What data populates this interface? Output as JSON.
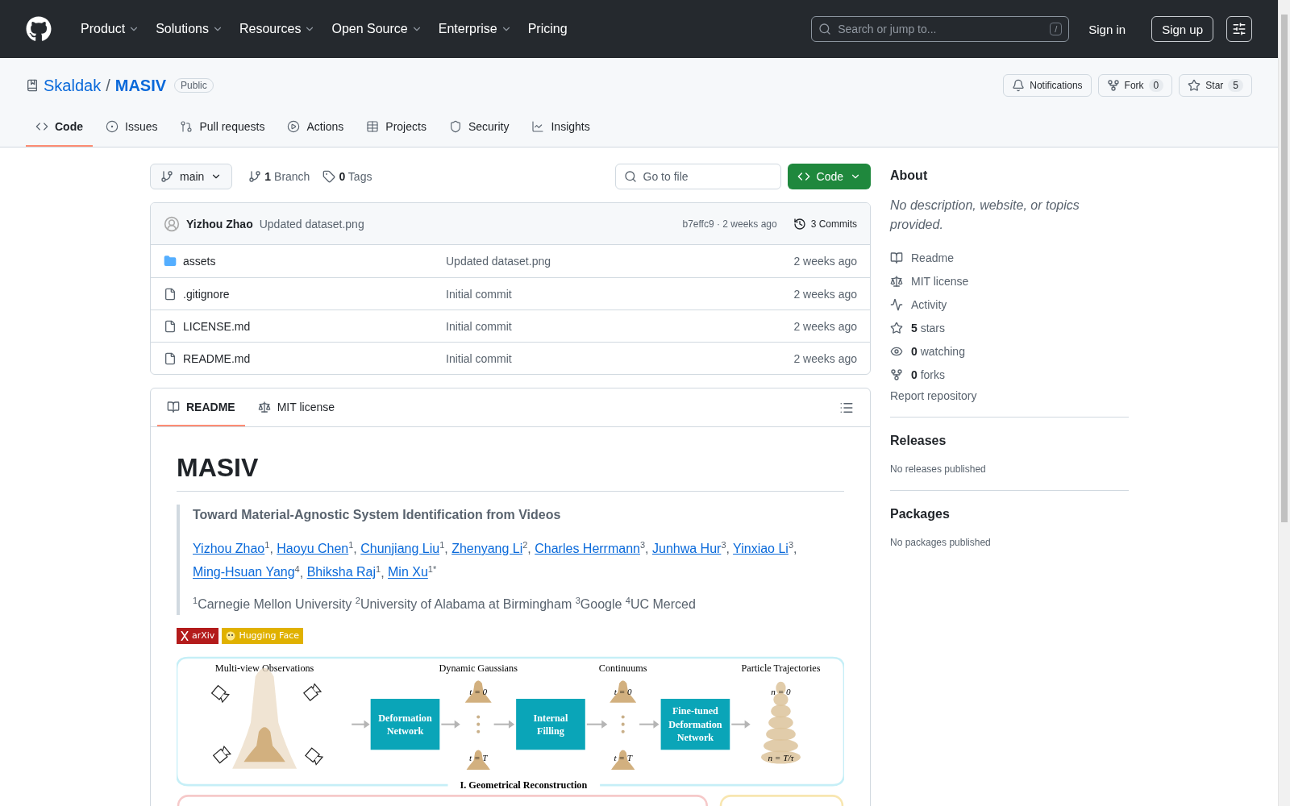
{
  "header": {
    "nav": [
      {
        "label": "Product",
        "dropdown": true
      },
      {
        "label": "Solutions",
        "dropdown": true
      },
      {
        "label": "Resources",
        "dropdown": true
      },
      {
        "label": "Open Source",
        "dropdown": true
      },
      {
        "label": "Enterprise",
        "dropdown": true
      },
      {
        "label": "Pricing",
        "dropdown": false
      }
    ],
    "search": {
      "placeholder": "Search or jump to...",
      "shortcut": "/"
    },
    "sign_in": "Sign in",
    "sign_up": "Sign up"
  },
  "repo": {
    "owner": "Skaldak",
    "separator": "/",
    "name": "MASIV",
    "visibility": "Public",
    "actions": [
      {
        "kind": "notifications",
        "label": "Notifications"
      },
      {
        "kind": "fork",
        "label": "Fork",
        "count": "0"
      },
      {
        "kind": "star",
        "label": "Star",
        "count": "5"
      }
    ],
    "tabs": [
      {
        "kind": "code",
        "label": "Code",
        "selected": true
      },
      {
        "kind": "issues",
        "label": "Issues",
        "selected": false
      },
      {
        "kind": "pulls",
        "label": "Pull requests",
        "selected": false
      },
      {
        "kind": "actions",
        "label": "Actions",
        "selected": false
      },
      {
        "kind": "projects",
        "label": "Projects",
        "selected": false
      },
      {
        "kind": "security",
        "label": "Security",
        "selected": false
      },
      {
        "kind": "insights",
        "label": "Insights",
        "selected": false
      }
    ]
  },
  "toolbar": {
    "branch": "main",
    "branches": "**1** Branch",
    "tags": "**0** Tags",
    "file_search": {
      "placeholder": "Go to file"
    },
    "code_button": "Code"
  },
  "latest_commit": {
    "author": "Yizhou Zhao",
    "message": "Updated dataset.png",
    "hash_age": "b7effc9 · 2 weeks ago",
    "commits": "3 Commits"
  },
  "files": [
    {
      "kind": "folder",
      "name": "assets",
      "message": "Updated dataset.png",
      "age": "2 weeks ago"
    },
    {
      "kind": "file",
      "name": ".gitignore",
      "message": "Initial commit",
      "age": "2 weeks ago"
    },
    {
      "kind": "file",
      "name": "LICENSE.md",
      "message": "Initial commit",
      "age": "2 weeks ago"
    },
    {
      "kind": "file",
      "name": "README.md",
      "message": "Initial commit",
      "age": "2 weeks ago"
    }
  ],
  "readme": {
    "tabs": [
      {
        "kind": "readme",
        "label": "README",
        "selected": true
      },
      {
        "kind": "license",
        "label": "MIT license",
        "selected": false
      }
    ],
    "title": "MASIV",
    "subtitle": "Toward Material-Agnostic System Identification from Videos",
    "authors": [
      {
        "name": "Yizhou Zhao",
        "note": "$^{1}$,"
      },
      {
        "name": "Haoyu Chen",
        "note": "$^{1}$,"
      },
      {
        "name": "Chunjiang Liu",
        "note": "$^{1}$,"
      },
      {
        "name": "Zhenyang Li",
        "note": "$^{2}$,"
      },
      {
        "name": "Charles Herrmann",
        "note": "$^{3}$,"
      },
      {
        "name": "Junhwa Hur",
        "note": "$^{3}$,"
      },
      {
        "name": "Yinxiao Li",
        "note": "$^{3}$,"
      },
      {
        "name": "Ming-Hsuan Yang",
        "note": "$^{4}$,"
      },
      {
        "name": "Bhiksha Raj",
        "note": "$^{1}$,"
      },
      {
        "name": "Min Xu",
        "note": "$^{1*}$"
      }
    ],
    "affiliations": "$^{1}$Carnegie Mellon University $^{2}$University of Alabama at Birmingham $^{3}$Google $^{4}$UC Merced",
    "badges": [
      {
        "kind": "arxiv",
        "label": "arXiv",
        "color": "#b31b1b"
      },
      {
        "kind": "huggingface",
        "label": "Hugging Face",
        "color": "#e0b100"
      }
    ],
    "figure": {
      "stages": [
        "Multi-view Observations",
        "Dynamic Gaussians",
        "Continuums",
        "Particle Trajectories"
      ],
      "blocks": [
        {
          "lines": [
            "Deformation",
            "Network"
          ]
        },
        {
          "lines": [
            "Internal",
            "Filling"
          ]
        },
        {
          "lines": [
            "Fine-tuned",
            "Deformation",
            "Network"
          ]
        }
      ],
      "time_labels": [
        {
          "top": "t = 0",
          "bottom": "t = T"
        },
        {
          "top": "t = 0",
          "bottom": "t = T"
        },
        {
          "top": "n = 0",
          "bottom": "n = T/τ"
        }
      ],
      "section": "I. Geometrical Reconstruction"
    }
  },
  "sidebar": {
    "about": {
      "title": "About",
      "description": "No description, website, or topics provided.",
      "links": [
        {
          "kind": "readme",
          "label": "Readme"
        },
        {
          "kind": "license",
          "label": "MIT license"
        },
        {
          "kind": "activity",
          "label": "Activity"
        },
        {
          "kind": "stars",
          "label": "**5** stars"
        },
        {
          "kind": "watching",
          "label": "**0** watching"
        },
        {
          "kind": "forks",
          "label": "**0** forks"
        }
      ],
      "report": "Report repository"
    },
    "sections": [
      {
        "title": "Releases",
        "note": "No releases published"
      },
      {
        "title": "Packages",
        "note": "No packages published"
      }
    ]
  }
}
